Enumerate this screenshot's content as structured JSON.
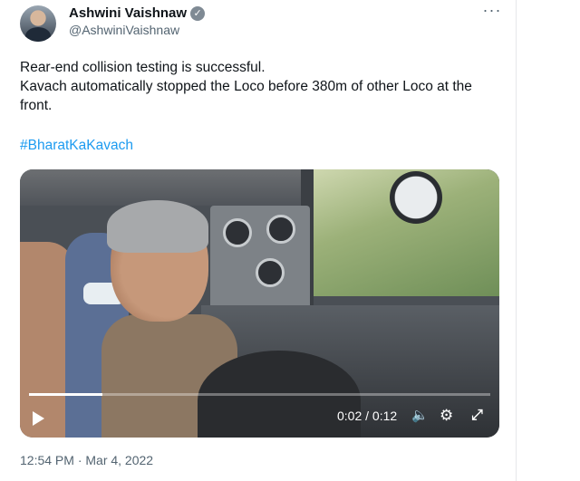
{
  "author": {
    "display_name": "Ashwini Vaishnaw",
    "handle": "@AshwiniVaishnaw",
    "verified_badge": "✓"
  },
  "tweet": {
    "line1": "Rear-end collision testing is successful.",
    "line2": "Kavach automatically stopped the Loco before 380m of other Loco at the front.",
    "hashtag": "#BharatKaKavach",
    "timestamp": "12:54 PM · Mar 4, 2022"
  },
  "video": {
    "time": "0:02 / 0:12",
    "progress": 0.16
  },
  "icons": {
    "more": "···",
    "volume": "🔈",
    "settings": "⚙",
    "expand": "⤢"
  },
  "colors": {
    "link": "#1d9bf0",
    "secondary_text": "#536471"
  }
}
